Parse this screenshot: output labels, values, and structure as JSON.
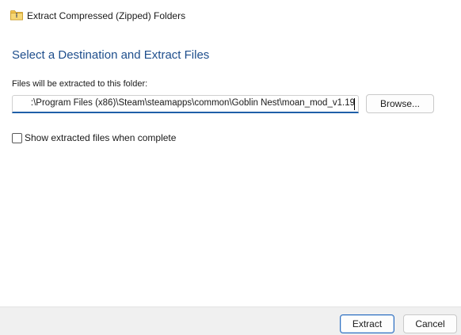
{
  "window": {
    "title": "Extract Compressed (Zipped) Folders",
    "title_icon": "zipped-folder-icon"
  },
  "main": {
    "heading": "Select a Destination and Extract Files",
    "path_label": "Files will be extracted to this folder:",
    "path_value": ":\\Program Files (x86)\\Steam\\steamapps\\common\\Goblin Nest\\moan_mod_v1.19",
    "browse_label": "Browse...",
    "show_files_label": "Show extracted files when complete",
    "show_files_checked": false
  },
  "footer": {
    "extract_label": "Extract",
    "cancel_label": "Cancel"
  },
  "colors": {
    "heading": "#1e4e8c",
    "accent": "#1f5fa8",
    "footer_bg": "#f0f0f0"
  }
}
